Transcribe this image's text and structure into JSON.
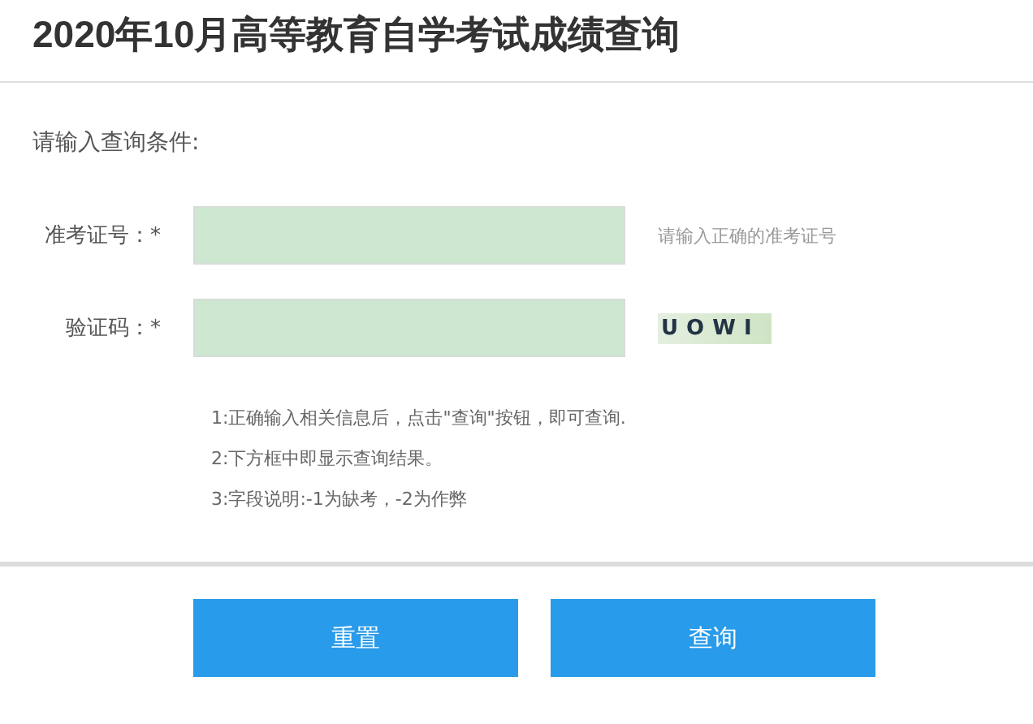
{
  "title": "2020年10月高等教育自学考试成绩查询",
  "prompt": "请输入查询条件:",
  "fields": [
    {
      "label": "准考证号：*",
      "kind": "hint",
      "hint": "请输入正确的准考证号"
    },
    {
      "label": "验证码：*",
      "kind": "captcha",
      "captcha_text": "UOWI"
    }
  ],
  "notes": [
    "1:正确输入相关信息后，点击\"查询\"按钮，即可查询.",
    "2:下方框中即显示查询结果。",
    "3:字段说明:-1为缺考，-2为作弊"
  ],
  "buttons": [
    "重置",
    "查询"
  ]
}
